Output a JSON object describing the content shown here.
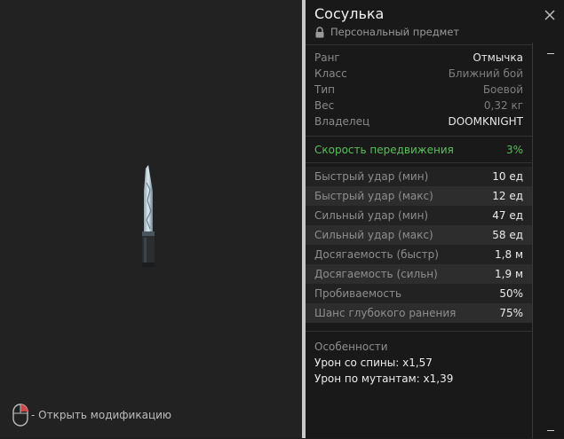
{
  "viewer": {
    "hint_text": "- Открыть модификацию"
  },
  "item": {
    "title": "Сосулька",
    "subtitle": "Персональный предмет"
  },
  "info": [
    {
      "label": "Ранг",
      "value": "Отмычка"
    },
    {
      "label": "Класс",
      "value": "Ближний бой"
    },
    {
      "label": "Тип",
      "value": "Боевой"
    },
    {
      "label": "Вес",
      "value": "0,32 кг"
    },
    {
      "label": "Владелец",
      "value": "DOOMKNIGHT"
    }
  ],
  "speed": {
    "label": "Скорость передвижения",
    "value": "3%",
    "color": "#56c156"
  },
  "stats": [
    {
      "label": "Быстрый удар (мин)",
      "value": "10 ед"
    },
    {
      "label": "Быстрый удар (макс)",
      "value": "12 ед"
    },
    {
      "label": "Сильный удар (мин)",
      "value": "47 ед"
    },
    {
      "label": "Сильный удар (макс)",
      "value": "58 ед"
    },
    {
      "label": "Досягаемость (быстр)",
      "value": "1,8 м"
    },
    {
      "label": "Досягаемость (сильн)",
      "value": "1,9 м"
    },
    {
      "label": "Пробиваемость",
      "value": "50%"
    },
    {
      "label": "Шанс глубокого ранения",
      "value": "75%"
    }
  ],
  "features": {
    "heading": "Особенности",
    "items": [
      "Урон со спины: x1,57",
      "Урон по мутантам: x1,39"
    ]
  },
  "icons": {
    "close": "close-icon",
    "lock": "lock-icon",
    "mouse": "mouse-right-click-icon"
  }
}
